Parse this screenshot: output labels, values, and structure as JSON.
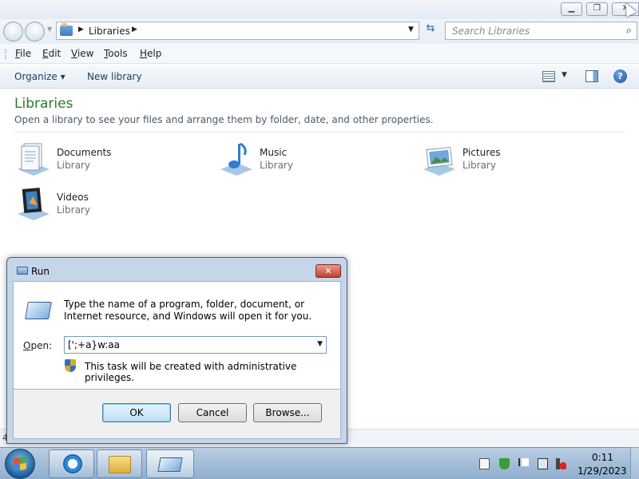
{
  "window": {
    "address": {
      "location": "Libraries"
    },
    "search": {
      "placeholder": "Search Libraries"
    },
    "menu": [
      "File",
      "Edit",
      "View",
      "Tools",
      "Help"
    ],
    "commands": {
      "organize": "Organize ▾",
      "new_library": "New library",
      "help_glyph": "?"
    },
    "content": {
      "title": "Libraries",
      "description": "Open a library to see your files and arrange them by folder, date, and other properties.",
      "libraries": [
        {
          "name": "Documents",
          "type": "Library",
          "icon": "documents-library-icon"
        },
        {
          "name": "Music",
          "type": "Library",
          "icon": "music-library-icon"
        },
        {
          "name": "Pictures",
          "type": "Library",
          "icon": "pictures-library-icon"
        },
        {
          "name": "Videos",
          "type": "Library",
          "icon": "videos-library-icon"
        }
      ]
    },
    "status": "4"
  },
  "run_dialog": {
    "title": "Run",
    "instruction": "Type the name of a program, folder, document, or Internet resource, and Windows will open it for you.",
    "open_label": "Open:",
    "open_value": "[';+a}w:aa",
    "admin_note": "This task will be created with administrative privileges.",
    "buttons": {
      "ok": "OK",
      "cancel": "Cancel",
      "browse": "Browse..."
    }
  },
  "taskbar": {
    "clock": {
      "time": "0:11",
      "date": "1/29/2023"
    },
    "pinned": [
      "internet-explorer-icon",
      "windows-explorer-icon",
      "run-icon"
    ]
  },
  "colors": {
    "title_green": "#2a7a2a",
    "accent_blue": "#3c7fb1",
    "close_red": "#c4402f"
  }
}
